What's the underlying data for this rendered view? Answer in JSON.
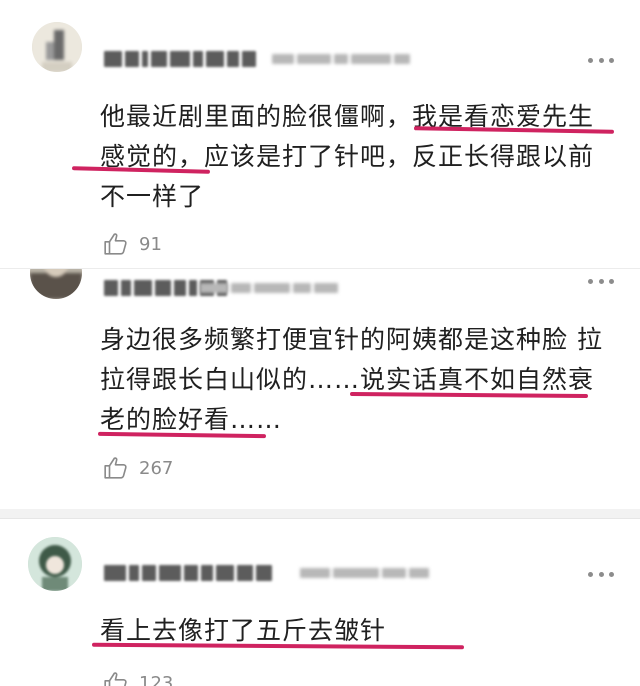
{
  "comments": [
    {
      "text_lines": [
        "他最近剧里面的脸很僵啊，我是看恋爱先生",
        "感觉的，应该是打了针吧，反正长得跟以前",
        "不一样了"
      ],
      "likes": "91"
    },
    {
      "text_lines": [
        "身边很多频繁打便宜针的阿姨都是这种脸 拉",
        "拉得跟长白山似的……说实话真不如自然衰",
        "老的脸好看……"
      ],
      "likes": "267"
    },
    {
      "text_lines": [
        "看上去像打了五斤去皱针"
      ],
      "likes": "123"
    }
  ],
  "icons": {
    "like": "thumbs-up-icon",
    "more": "more-dots-icon"
  },
  "colors": {
    "underline": "#cf2360",
    "text": "#202020",
    "meta": "#8a8a8a",
    "background": "#f2f2f2"
  }
}
